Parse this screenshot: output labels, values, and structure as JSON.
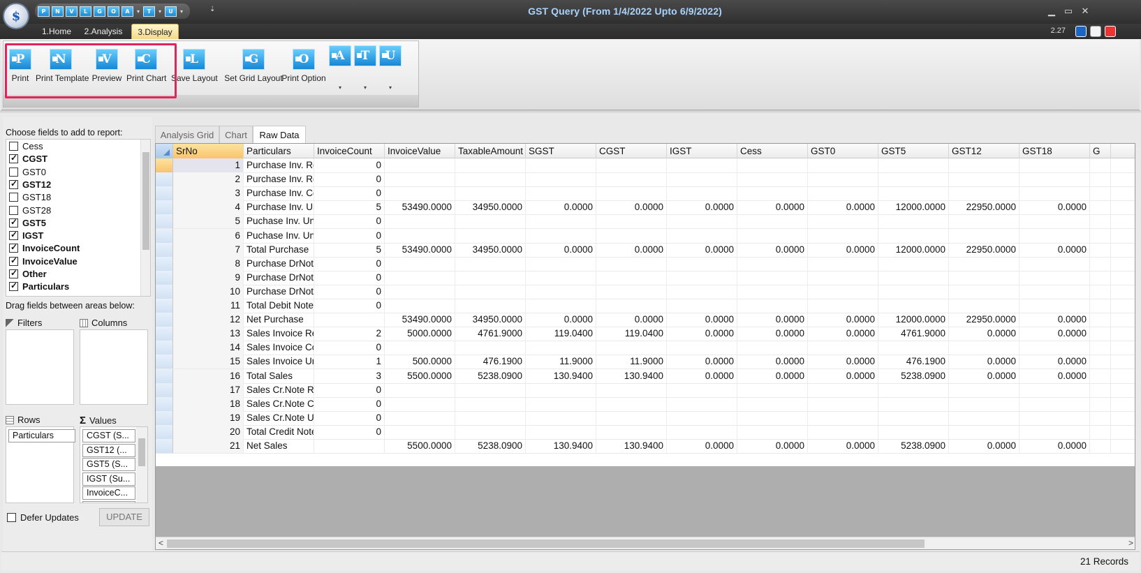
{
  "window": {
    "title": "GST Query (From 1/4/2022 Upto 6/9/2022)",
    "minimize": "▁",
    "maximize": "▭",
    "close": "✕",
    "version": "2.27",
    "qat_more": "⇣"
  },
  "quick_access": [
    {
      "letter": "P"
    },
    {
      "letter": "N"
    },
    {
      "letter": "V"
    },
    {
      "letter": "L"
    },
    {
      "letter": "G"
    },
    {
      "letter": "O"
    },
    {
      "letter": "A"
    },
    {
      "letter": "T"
    },
    {
      "letter": "U"
    }
  ],
  "ribbon_tabs": [
    {
      "label": "1.Home",
      "active": false
    },
    {
      "label": "2.Analysis",
      "active": false
    },
    {
      "label": "3.Display",
      "active": true
    }
  ],
  "ribbon": {
    "buttons": [
      {
        "letter": "P",
        "label": "Print"
      },
      {
        "letter": "N",
        "label": "Print Template"
      },
      {
        "letter": "V",
        "label": "Preview"
      },
      {
        "letter": "C",
        "label": "Print Chart"
      },
      {
        "letter": "L",
        "label": "Save Layout"
      },
      {
        "letter": "G",
        "label": "Set Grid Layout"
      },
      {
        "letter": "O",
        "label": "Print Option"
      }
    ],
    "small_buttons": [
      {
        "letter": "A"
      },
      {
        "letter": "T"
      },
      {
        "letter": "U"
      }
    ],
    "dropdown_arrow": "▾"
  },
  "field_panel": {
    "choose_label": "Choose fields to add to report:",
    "fields": [
      {
        "name": "Cess",
        "checked": false
      },
      {
        "name": "CGST",
        "checked": true
      },
      {
        "name": "GST0",
        "checked": false
      },
      {
        "name": "GST12",
        "checked": true
      },
      {
        "name": "GST18",
        "checked": false
      },
      {
        "name": "GST28",
        "checked": false
      },
      {
        "name": "GST5",
        "checked": true
      },
      {
        "name": "IGST",
        "checked": true
      },
      {
        "name": "InvoiceCount",
        "checked": true
      },
      {
        "name": "InvoiceValue",
        "checked": true
      },
      {
        "name": "Other",
        "checked": true
      },
      {
        "name": "Particulars",
        "checked": true
      }
    ],
    "drag_label": "Drag fields between areas below:",
    "filters_label": "Filters",
    "columns_label": "Columns",
    "rows_label": "Rows",
    "values_label": "Values",
    "rows_items": [
      "Particulars"
    ],
    "values_items": [
      "CGST (S...",
      "GST12 (...",
      "GST5 (S...",
      "IGST (Su...",
      "InvoiceC...",
      "InvoiceV..."
    ],
    "defer_label": "Defer Updates",
    "update_label": "UPDATE"
  },
  "grid_tabs": [
    {
      "label": "Analysis Grid",
      "active": false
    },
    {
      "label": "Chart",
      "active": false
    },
    {
      "label": "Raw Data",
      "active": true
    }
  ],
  "grid": {
    "columns": [
      "SrNo",
      "Particulars",
      "InvoiceCount",
      "InvoiceValue",
      "TaxableAmount",
      "SGST",
      "CGST",
      "IGST",
      "Cess",
      "GST0",
      "GST5",
      "GST12",
      "GST18",
      "G"
    ],
    "rows": [
      [
        "1",
        "Purchase Inv. Re",
        "0",
        "",
        "",
        "",
        "",
        "",
        "",
        "",
        "",
        "",
        ""
      ],
      [
        "2",
        "Purchase Inv. Re",
        "0",
        "",
        "",
        "",
        "",
        "",
        "",
        "",
        "",
        "",
        ""
      ],
      [
        "3",
        "Purchase Inv. Co",
        "0",
        "",
        "",
        "",
        "",
        "",
        "",
        "",
        "",
        "",
        ""
      ],
      [
        "4",
        "Purchase Inv. Un",
        "5",
        "53490.0000",
        "34950.0000",
        "0.0000",
        "0.0000",
        "0.0000",
        "0.0000",
        "0.0000",
        "12000.0000",
        "22950.0000",
        "0.0000"
      ],
      [
        "5",
        "Puchase Inv. Unl",
        "0",
        "",
        "",
        "",
        "",
        "",
        "",
        "",
        "",
        "",
        ""
      ],
      [
        "6",
        "Puchase Inv. Unl",
        "0",
        "",
        "",
        "",
        "",
        "",
        "",
        "",
        "",
        "",
        ""
      ],
      [
        "7",
        "Total Purchase",
        "5",
        "53490.0000",
        "34950.0000",
        "0.0000",
        "0.0000",
        "0.0000",
        "0.0000",
        "0.0000",
        "12000.0000",
        "22950.0000",
        "0.0000"
      ],
      [
        "8",
        "Purchase DrNote",
        "0",
        "",
        "",
        "",
        "",
        "",
        "",
        "",
        "",
        "",
        ""
      ],
      [
        "9",
        "Purchase DrNote",
        "0",
        "",
        "",
        "",
        "",
        "",
        "",
        "",
        "",
        "",
        ""
      ],
      [
        "10",
        "Purchase DrNote",
        "0",
        "",
        "",
        "",
        "",
        "",
        "",
        "",
        "",
        "",
        ""
      ],
      [
        "11",
        "Total Debit Note",
        "0",
        "",
        "",
        "",
        "",
        "",
        "",
        "",
        "",
        "",
        ""
      ],
      [
        "12",
        "Net Purchase",
        "",
        "53490.0000",
        "34950.0000",
        "0.0000",
        "0.0000",
        "0.0000",
        "0.0000",
        "0.0000",
        "12000.0000",
        "22950.0000",
        "0.0000"
      ],
      [
        "13",
        "Sales Invoice Re",
        "2",
        "5000.0000",
        "4761.9000",
        "119.0400",
        "119.0400",
        "0.0000",
        "0.0000",
        "0.0000",
        "4761.9000",
        "0.0000",
        "0.0000"
      ],
      [
        "14",
        "Sales Invoice Co",
        "0",
        "",
        "",
        "",
        "",
        "",
        "",
        "",
        "",
        "",
        ""
      ],
      [
        "15",
        "Sales Invoice Ur",
        "1",
        "500.0000",
        "476.1900",
        "11.9000",
        "11.9000",
        "0.0000",
        "0.0000",
        "0.0000",
        "476.1900",
        "0.0000",
        "0.0000"
      ],
      [
        "16",
        "Total Sales",
        "3",
        "5500.0000",
        "5238.0900",
        "130.9400",
        "130.9400",
        "0.0000",
        "0.0000",
        "0.0000",
        "5238.0900",
        "0.0000",
        "0.0000"
      ],
      [
        "17",
        "Sales Cr.Note Re",
        "0",
        "",
        "",
        "",
        "",
        "",
        "",
        "",
        "",
        "",
        ""
      ],
      [
        "18",
        "Sales Cr.Note Co",
        "0",
        "",
        "",
        "",
        "",
        "",
        "",
        "",
        "",
        "",
        ""
      ],
      [
        "19",
        "Sales Cr.Note Ur",
        "0",
        "",
        "",
        "",
        "",
        "",
        "",
        "",
        "",
        "",
        ""
      ],
      [
        "20",
        "Total Credit Note",
        "0",
        "",
        "",
        "",
        "",
        "",
        "",
        "",
        "",
        "",
        ""
      ],
      [
        "21",
        "Net Sales",
        "",
        "5500.0000",
        "5238.0900",
        "130.9400",
        "130.9400",
        "0.0000",
        "0.0000",
        "0.0000",
        "5238.0900",
        "0.0000",
        "0.0000"
      ]
    ],
    "scroll_left": "<",
    "scroll_right": ">"
  },
  "status": {
    "records": "21 Records"
  },
  "colors": {
    "highlight": "#e3245b",
    "title_text": "#a9d3ff",
    "icon_blue": "#1687d7"
  }
}
